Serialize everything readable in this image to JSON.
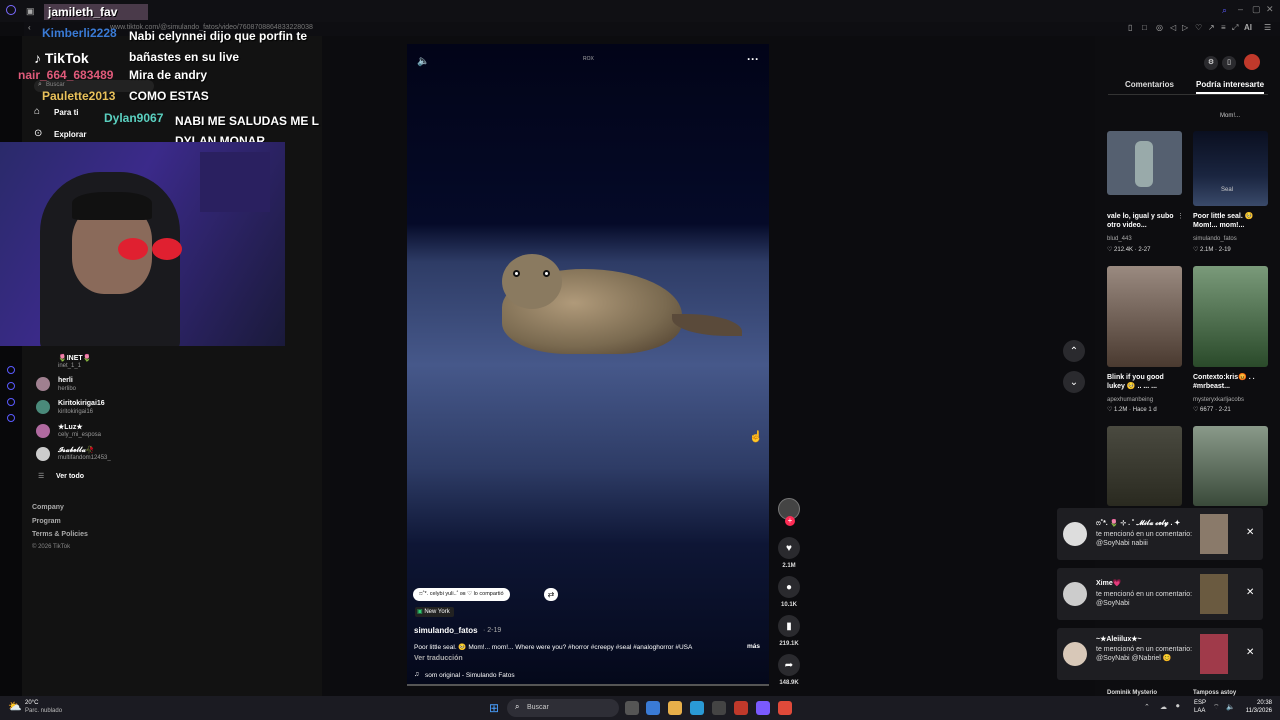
{
  "browser": {
    "url": "www.tiktok.com/@simulando_fatos/video/7608708864833228038",
    "right_icons": [
      "bookmark-icon",
      "extensions-icon",
      "profile-icon",
      "play-icon",
      "heart-icon",
      "share-icon",
      "menu-icon"
    ],
    "ai_label": "AI"
  },
  "stream_overlay": {
    "channel_name": "jamileth_fav",
    "chat": [
      {
        "user": "Kimberli2228",
        "color": "#3a7bd5",
        "msg": "Nabi celynnei dijo que porfin te bañastes en su live"
      },
      {
        "user": "nair_664_683489",
        "color": "#e05a7a",
        "msg": "Mira de andry"
      },
      {
        "user": "Paulette2013",
        "color": "#e8c05a",
        "msg": "COMO ESTAS"
      },
      {
        "user": "Dylan9067",
        "color": "#5ad0c0",
        "msg": "NABI ME SALUDAS ME L DYLAN MONAR"
      }
    ]
  },
  "sidebar": {
    "logo": "TikTok",
    "search_placeholder": "Buscar",
    "nav": [
      {
        "label": "Para ti",
        "icon": "home-icon"
      },
      {
        "label": "Explorar",
        "icon": "compass-icon"
      }
    ],
    "following": [
      {
        "name": "🌷INET🌷",
        "handle": "inet_1_1"
      },
      {
        "name": "herli",
        "handle": "herlibo"
      },
      {
        "name": "Kiritokirigai16",
        "handle": "kiritokirigai16"
      },
      {
        "name": "★Luz★",
        "handle": "cely_mi_esposa"
      },
      {
        "name": "𝓘𝓼𝓪𝓫𝓮𝓵𝓵𝓪🥀",
        "handle": "multifandom12453_"
      }
    ],
    "see_all": "Ver todo",
    "footer": [
      "Company",
      "Program",
      "Terms & Policies"
    ],
    "copyright": "© 2026 TikTok"
  },
  "video": {
    "badge": "ROX",
    "share_chip": "ෆ˚*. celybi yuli..˚ ʚɞ ♡ lo compartió",
    "location": "New York",
    "author": "simulando_fatos",
    "date": "· 2-19",
    "caption": "Poor little seal. 🥺 Mom!... mom!... Where were you? #horror #creepy #seal #analoghorror #USA",
    "more": "más",
    "translate": "Ver traducción",
    "sound": "som original - Simulando Fatos",
    "counts": {
      "likes": "2.1M",
      "comments": "10.1K",
      "saves": "219.1K",
      "shares": "148.9K"
    }
  },
  "right_panel": {
    "tabs": [
      "Comentarios",
      "Podría interesarte"
    ],
    "active_tab": 1,
    "partial_label": "Mom!...",
    "items": [
      {
        "caption": "vale lo, igual y subo otro video...",
        "author": "blud_443",
        "likes": "212.4K",
        "date": "2-27",
        "thumb": "#556070"
      },
      {
        "caption": "Poor little seal. 🥺 Mom!... mom!...",
        "author": "simulando_fatos",
        "likes": "2.1M",
        "date": "2-19",
        "thumb": "#1a2540",
        "overlay": "Seal"
      },
      {
        "caption": "Blink if you good lukey 🥺 .. ... ...",
        "author": "apexhumanbeing",
        "likes": "1.2M",
        "date": "Hace 1 d",
        "thumb": "#7a6a60"
      },
      {
        "caption": "Contexto:kris😡 . . #mrbeast...",
        "author": "mysteryxkarljacobs",
        "likes": "6677",
        "date": "2-21",
        "thumb": "#4a6a4a"
      },
      {
        "caption": "",
        "author": "",
        "likes": "",
        "date": "",
        "thumb": "#3a3a30"
      },
      {
        "caption": "",
        "author": "",
        "likes": "",
        "date": "",
        "thumb": "#506050"
      }
    ],
    "bottom_labels": [
      "Dominik Mysterio",
      "Tamposs astoy"
    ]
  },
  "notifications": [
    {
      "user": "ෆ˚*. 🌷 ⊹ . ˚ 𝓜𝓲𝓵𝓪 𝓬𝓮𝓵𝔂 . ✦",
      "text": "te mencionó en un comentario: @SoyNabi nabiii",
      "avatar": "#ddd",
      "thumb": "#8a7a6a"
    },
    {
      "user": "Xime💗",
      "text": "te mencionó en un comentario: @SoyNabi",
      "avatar": "#ccc",
      "thumb": "#6a5a40"
    },
    {
      "user": "~★Aleiilux★~",
      "text": "te mencionó en un comentario: @SoyNabi @Nabriel 😊",
      "avatar": "#d8c8b8",
      "thumb": "#a03a4a"
    }
  ],
  "taskbar": {
    "weather_temp": "20°C",
    "weather_desc": "Parc. nublado",
    "search": "Buscar",
    "lang": "ESP",
    "lang_sub": "LAA",
    "time": "20:38",
    "date": "11/3/2026"
  }
}
